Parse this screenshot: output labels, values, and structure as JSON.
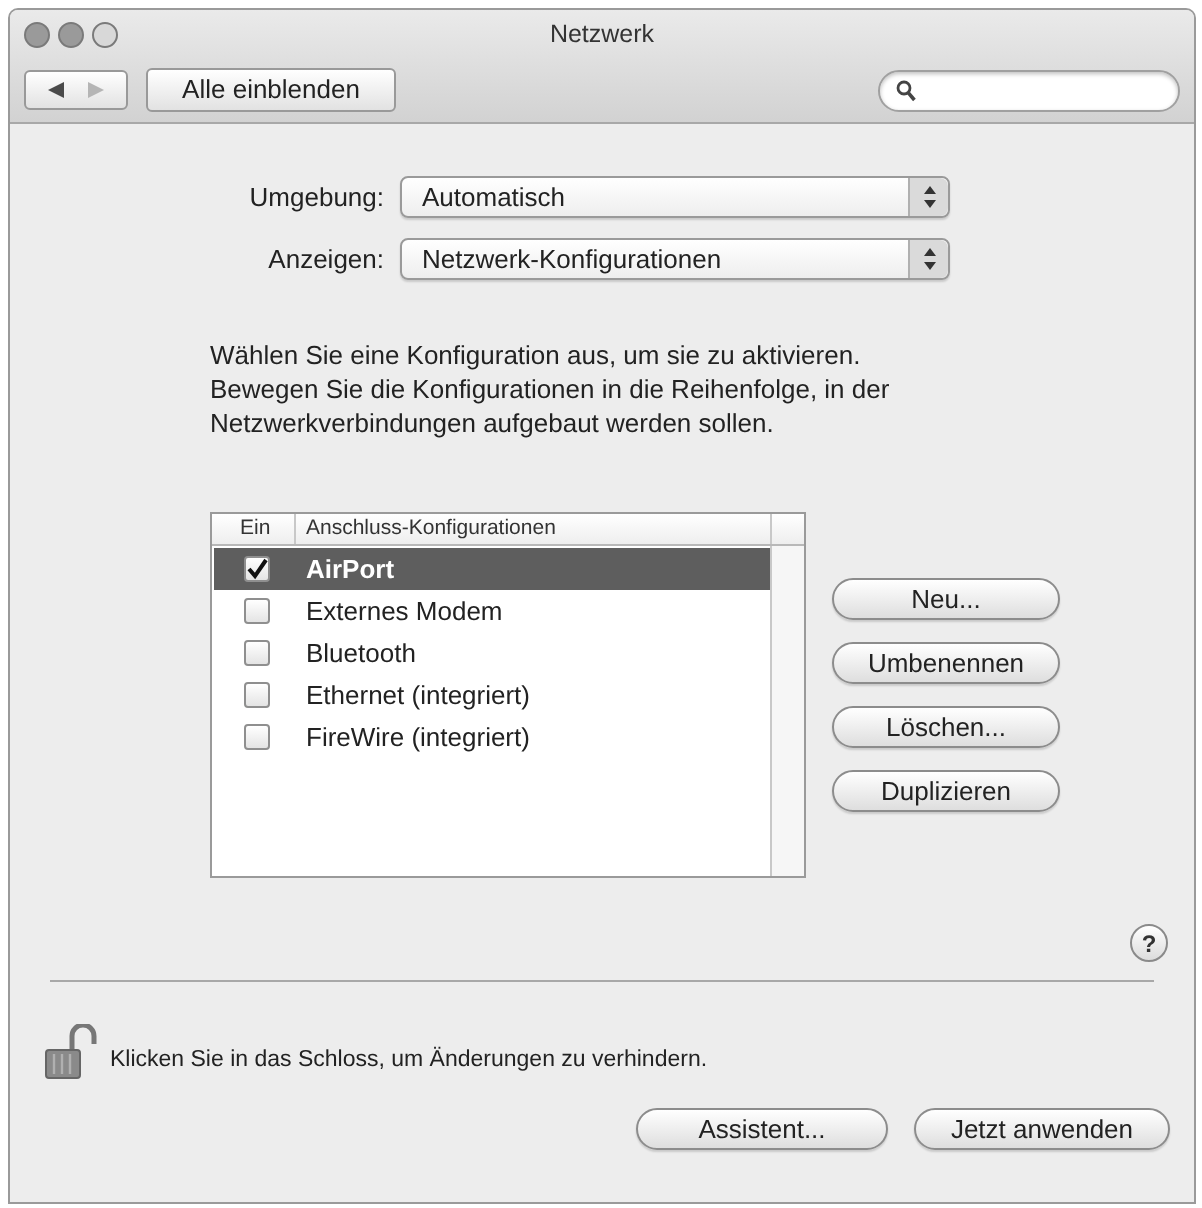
{
  "window": {
    "title": "Netzwerk"
  },
  "toolbar": {
    "nav_buttons": [
      {
        "kind": "back",
        "disabled": false
      },
      {
        "kind": "forward",
        "disabled": true
      }
    ],
    "show_all_button": "Alle einblenden"
  },
  "settings": [
    {
      "label": "Umgebung:",
      "value": "Automatisch"
    },
    {
      "label": "Anzeigen:",
      "value": "Netzwerk-Konfigurationen"
    }
  ],
  "instructions": "Wählen Sie eine Konfiguration aus, um sie zu aktivieren. Bewegen Sie die Konfigurationen in die Reihenfolge, in der Netzwerkverbindungen aufgebaut werden sollen.",
  "list": {
    "columns": [
      "Ein",
      "Anschluss-Konfigurationen"
    ],
    "rows": [
      {
        "name": "AirPort",
        "checked": true,
        "selected": true
      },
      {
        "name": "Externes Modem",
        "checked": false,
        "selected": false
      },
      {
        "name": "Bluetooth",
        "checked": false,
        "selected": false
      },
      {
        "name": "Ethernet (integriert)",
        "checked": false,
        "selected": false
      },
      {
        "name": "FireWire (integriert)",
        "checked": false,
        "selected": false
      }
    ]
  },
  "list_buttons": [
    "Neu...",
    "Umbenennen",
    "Löschen...",
    "Duplizieren"
  ],
  "help_button": "?",
  "lock": {
    "locked": false,
    "text": "Klicken Sie in das Schloss, um Änderungen zu verhindern."
  },
  "footer_buttons": [
    "Assistent...",
    "Jetzt anwenden"
  ]
}
